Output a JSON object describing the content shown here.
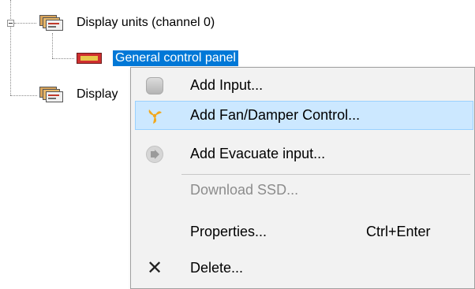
{
  "tree": {
    "nodes": [
      {
        "label": "Display units (channel 0)",
        "icon": "display-unit-icon",
        "expander": "minus"
      },
      {
        "label": "General control panel",
        "icon": "general-control-panel-icon",
        "selected": true
      },
      {
        "label": "Display",
        "icon": "display-unit-icon"
      }
    ]
  },
  "context_menu": {
    "items": [
      {
        "label": "Add Input...",
        "icon": "input-icon"
      },
      {
        "label": "Add Fan/Damper Control...",
        "icon": "fan-icon",
        "highlighted": true
      },
      {
        "label": "Add Evacuate input...",
        "icon": "speaker-icon"
      },
      {
        "label": "Download SSD...",
        "disabled": true
      },
      {
        "label": "Properties...",
        "shortcut": "Ctrl+Enter"
      },
      {
        "label": "Delete...",
        "icon": "close-icon"
      }
    ]
  },
  "colors": {
    "selection": "#0078d7",
    "menu_hover": "#cce8ff",
    "menu_hover_border": "#99d1ff",
    "fan_icon": "#f2a81d"
  }
}
